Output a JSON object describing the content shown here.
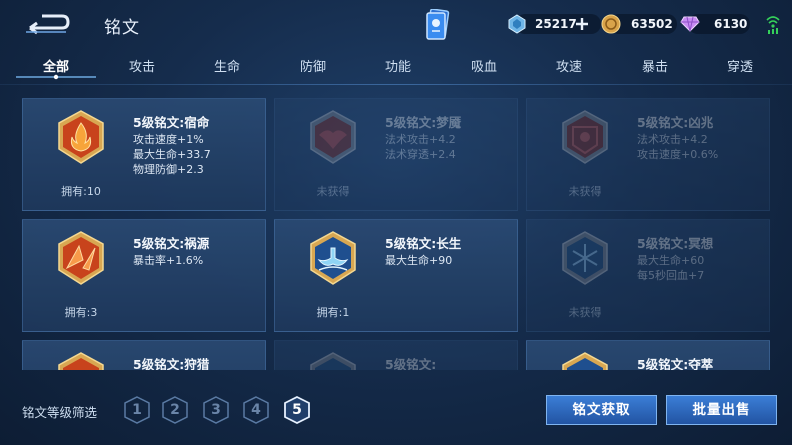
{
  "header": {
    "title": "铭文",
    "back_icon": "back-arrow-icon",
    "currencies": [
      {
        "icon": "gem-icon",
        "value": "25217",
        "add_icon": "plus-icon"
      },
      {
        "icon": "coin-icon",
        "value": "63502"
      },
      {
        "icon": "diamond-icon",
        "value": "6130"
      }
    ],
    "signal_icon": "wifi-icon"
  },
  "tabs": [
    {
      "label": "全部",
      "active": true
    },
    {
      "label": "攻击"
    },
    {
      "label": "生命"
    },
    {
      "label": "防御"
    },
    {
      "label": "功能"
    },
    {
      "label": "吸血"
    },
    {
      "label": "攻速"
    },
    {
      "label": "暴击"
    },
    {
      "label": "穿透"
    }
  ],
  "cards": [
    {
      "name": "5级铭文:宿命",
      "stats": [
        "攻击速度+1%",
        "最大生命+33.7",
        "物理防御+2.3"
      ],
      "owned": "拥有:10",
      "locked": false,
      "color": "#c8431c"
    },
    {
      "name": "5级铭文:梦魇",
      "stats": [
        "法术攻击+4.2",
        "法术穿透+2.4"
      ],
      "owned": "未获得",
      "locked": true,
      "color": "#b3341f"
    },
    {
      "name": "5级铭文:凶兆",
      "stats": [
        "法术攻击+4.2",
        "攻击速度+0.6%"
      ],
      "owned": "未获得",
      "locked": true,
      "color": "#b3341f"
    },
    {
      "name": "5级铭文:祸源",
      "stats": [
        "暴击率+1.6%"
      ],
      "owned": "拥有:3",
      "locked": false,
      "color": "#c8431c"
    },
    {
      "name": "5级铭文:长生",
      "stats": [
        "最大生命+90"
      ],
      "owned": "拥有:1",
      "locked": false,
      "color": "#2f6fb8"
    },
    {
      "name": "5级铭文:冥想",
      "stats": [
        "最大生命+60",
        "每5秒回血+7"
      ],
      "owned": "未获得",
      "locked": true,
      "color": "#2f6fb8"
    },
    {
      "name": "5级铭文:狩猎",
      "stats": [],
      "owned": "",
      "locked": false,
      "color": "#c8431c"
    },
    {
      "name": "5级铭文:",
      "stats": [],
      "owned": "",
      "locked": true,
      "color": "#2f6fb8"
    },
    {
      "name": "5级铭文:夺萃",
      "stats": [],
      "owned": "",
      "locked": false,
      "color": "#2f6fb8"
    }
  ],
  "filter": {
    "label": "铭文等级筛选",
    "levels": [
      "1",
      "2",
      "3",
      "4",
      "5"
    ],
    "active_level": "5"
  },
  "buttons": {
    "acquire": "铭文获取",
    "bulk_sell": "批量出售"
  }
}
